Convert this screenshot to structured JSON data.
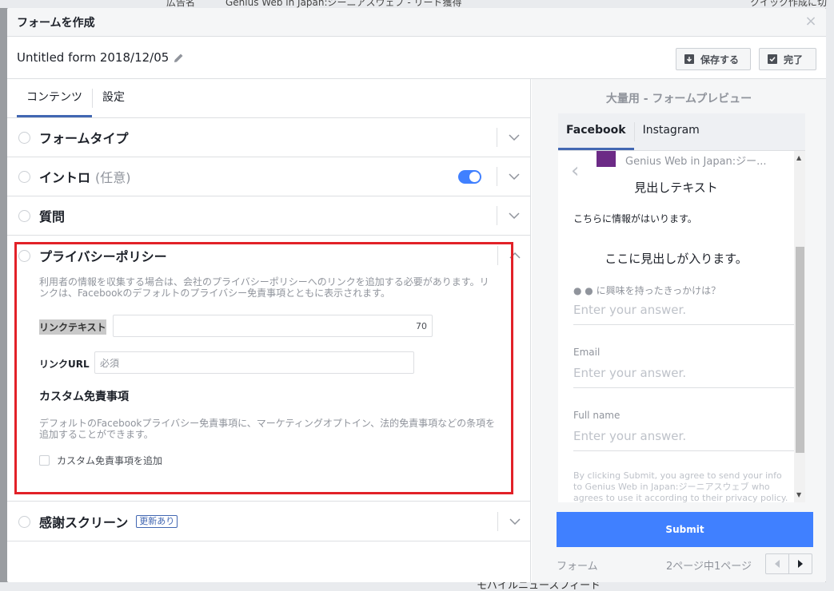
{
  "background": {
    "top_label": "広告名",
    "top_value": "Genius Web in Japan:ジーニアスウェブ - リード獲得",
    "top_right": "クイック作成に切り",
    "bottom_label": "モバイルニュースフィード"
  },
  "dialog": {
    "title": "フォームを作成",
    "close_icon": "close-icon"
  },
  "form": {
    "name": "Untitled form 2018/12/05",
    "save_label": "保存する",
    "done_label": "完了"
  },
  "tabs": {
    "content": "コンテンツ",
    "settings": "設定"
  },
  "sections": {
    "form_type": "フォームタイプ",
    "intro": "イントロ",
    "intro_optional": "(任意)",
    "questions": "質問",
    "privacy": "プライバシーポリシー",
    "thanks": "感謝スクリーン",
    "thanks_badge": "更新あり"
  },
  "privacy": {
    "description": "利用者の情報を収集する場合は、会社のプライバシーポリシーへのリンクを追加する必要があります。リンクは、Facebookのデフォルトのプライバシー免責事項とともに表示されます。",
    "link_text_label": "リンクテキスト",
    "link_text_counter": "70",
    "link_url_label": "リンクURL",
    "link_url_placeholder": "必須",
    "custom_title": "カスタム免責事項",
    "custom_desc": "デフォルトのFacebookプライバシー免責事項に、マーケティングオプトイン、法的免責事項などの条項を追加することができます。",
    "custom_checkbox": "カスタム免責事項を追加"
  },
  "preview": {
    "title": "大量用 - フォームプレビュー",
    "tab_facebook": "Facebook",
    "tab_instagram": "Instagram",
    "page_name": "Genius Web in Japan:ジー...",
    "headline": "見出しテキスト",
    "info": "こちらに情報がはいります。",
    "headline2": "ここに見出しが入ります。",
    "question": "● ● に興味を持ったきっかけは？",
    "answer_placeholder": "Enter your answer.",
    "email_label": "Email",
    "fullname_label": "Full name",
    "legal": "By clicking Submit, you agree to send your info to Genius Web in Japan:ジーニアスウェブ who agrees to use it according to their privacy policy.",
    "submit": "Submit",
    "footer_label": "フォーム",
    "pages": "2ページ中1ページ"
  }
}
